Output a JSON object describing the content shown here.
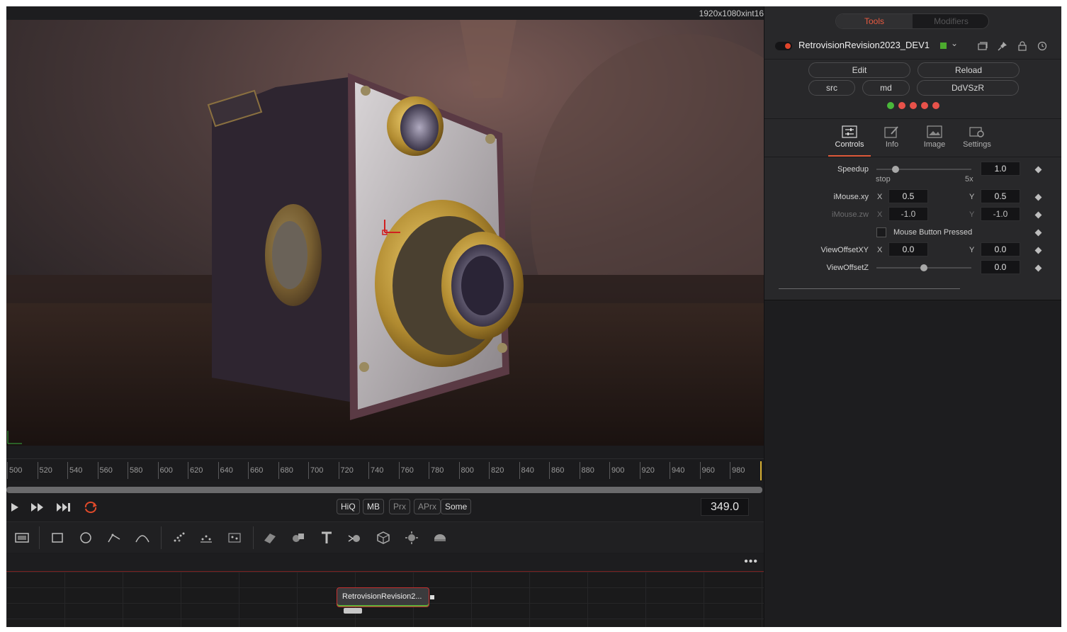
{
  "viewer": {
    "resolution": "1920x1080xint16"
  },
  "timeline": {
    "ticks": [
      "500",
      "520",
      "540",
      "560",
      "580",
      "600",
      "620",
      "640",
      "660",
      "680",
      "700",
      "720",
      "740",
      "760",
      "780",
      "800",
      "820",
      "840",
      "860",
      "880",
      "900",
      "920",
      "940",
      "960",
      "980"
    ],
    "current_frame": "349.0"
  },
  "transport": {
    "quality_buttons": [
      "HiQ",
      "MB",
      "Prx",
      "APrx",
      "Some"
    ]
  },
  "toolbar": {
    "icons": [
      "background-tool-icon",
      "rectangle-mask-icon",
      "ellipse-mask-icon",
      "polygon-mask-icon",
      "bspline-mask-icon",
      "particle-emitter-icon",
      "particle-render-icon",
      "particle-style-icon",
      "image-plane-3d-icon",
      "merge-3d-icon",
      "text-3d-icon",
      "renderer-3d-icon",
      "shape-3d-icon",
      "spotlight-icon",
      "camera-3d-icon"
    ]
  },
  "flow": {
    "more_label": "•••",
    "node_label": "RetrovisionRevision2..."
  },
  "inspector": {
    "tabs_top": {
      "tools": "Tools",
      "modifiers": "Modifiers"
    },
    "tool_name": "RetrovisionRevision2023_DEV1",
    "tool_color": "#4caa2e",
    "buttons": {
      "edit": "Edit",
      "reload": "Reload",
      "src": "src",
      "md": "md",
      "dvszr": "DdVSzR"
    },
    "status_dot_colors": [
      "#49b83a",
      "#e8524a",
      "#e8524a",
      "#e8524a",
      "#e8524a"
    ],
    "tabs": [
      "Controls",
      "Info",
      "Image",
      "Settings"
    ],
    "speedup": {
      "label": "Speedup",
      "value": "1.0",
      "min_label": "stop",
      "max_label": "5x",
      "level": 0.2
    },
    "imouse_xy": {
      "label": "iMouse.xy",
      "x_label": "X",
      "x": "0.5",
      "y_label": "Y",
      "y": "0.5"
    },
    "imouse_zw": {
      "label": "iMouse.zw",
      "x_label": "X",
      "x": "-1.0",
      "y_label": "Y",
      "y": "-1.0"
    },
    "mouse_button": {
      "label": "Mouse Button Pressed"
    },
    "view_offset_xy": {
      "label": "ViewOffsetXY",
      "x_label": "X",
      "x": "0.0",
      "y_label": "Y",
      "y": "0.0"
    },
    "view_offset_z": {
      "label": "ViewOffsetZ",
      "value": "0.0",
      "level": 0.5
    }
  }
}
